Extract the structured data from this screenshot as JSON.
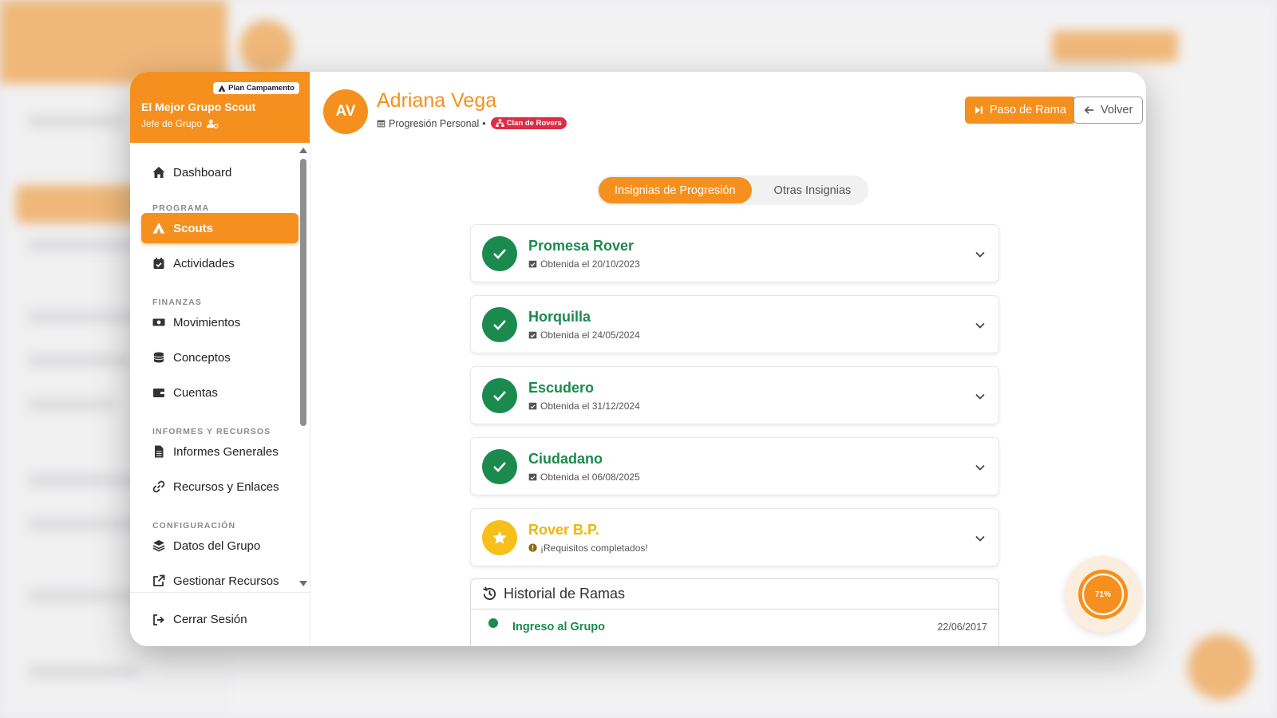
{
  "sidebar": {
    "plan_badge": "Plan Campamento",
    "group_name": "El Mejor Grupo Scout",
    "role": "Jefe de Grupo",
    "items": [
      {
        "label": "Dashboard",
        "icon": "home-icon"
      },
      {
        "label": "Scouts",
        "icon": "campfire-icon",
        "active": true
      },
      {
        "label": "Actividades",
        "icon": "calendar-check-icon"
      },
      {
        "label": "Movimientos",
        "icon": "money-icon"
      },
      {
        "label": "Conceptos",
        "icon": "coins-icon"
      },
      {
        "label": "Cuentas",
        "icon": "wallet-icon"
      },
      {
        "label": "Informes Generales",
        "icon": "file-icon"
      },
      {
        "label": "Recursos y Enlaces",
        "icon": "link-icon"
      },
      {
        "label": "Datos del Grupo",
        "icon": "layers-icon"
      },
      {
        "label": "Gestionar Recursos",
        "icon": "external-link-icon"
      }
    ],
    "sections": {
      "programa": "PROGRAMA",
      "finanzas": "FINANZAS",
      "informes": "INFORMES Y RECURSOS",
      "configuracion": "CONFIGURACIÓN"
    },
    "logout": "Cerrar Sesión"
  },
  "header": {
    "initials": "AV",
    "name": "Adriana Vega",
    "subtitle": "Progresión Personal",
    "separator": "•",
    "rama_badge": "Clan de Rovers",
    "paso_button": "Paso de Rama",
    "volver_button": "Volver"
  },
  "tabs": [
    {
      "label": "Insignias de Progresión",
      "active": true
    },
    {
      "label": "Otras Insignias",
      "active": false
    }
  ],
  "insignias": [
    {
      "title": "Promesa Rover",
      "status": "Obtenida el 20/10/2023",
      "state": "done"
    },
    {
      "title": "Horquilla",
      "status": "Obtenida el 24/05/2024",
      "state": "done"
    },
    {
      "title": "Escudero",
      "status": "Obtenida el 31/12/2024",
      "state": "done"
    },
    {
      "title": "Ciudadano",
      "status": "Obtenida el 06/08/2025",
      "state": "done"
    },
    {
      "title": "Rover B.P.",
      "status": "¡Requisitos completados!",
      "state": "pending"
    }
  ],
  "historial": {
    "title": "Historial de Ramas",
    "rows": [
      {
        "label": "Ingreso al Grupo",
        "date": "22/06/2017"
      }
    ]
  },
  "progress": {
    "value": 71,
    "label": "71%"
  },
  "colors": {
    "accent": "#f5901e",
    "success": "#1b8a4f",
    "warning": "#f8bf1b",
    "badge_red": "#dc2d45"
  }
}
